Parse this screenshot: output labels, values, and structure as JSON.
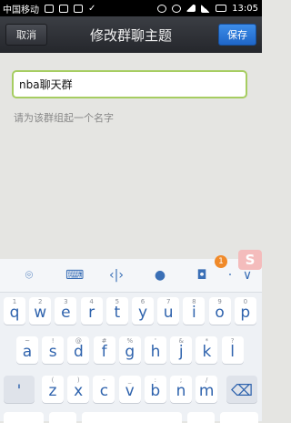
{
  "status_bar": {
    "carrier": "中国移动",
    "time": "13:05"
  },
  "header": {
    "cancel_label": "取消",
    "title": "修改群聊主题",
    "save_label": "保存"
  },
  "form": {
    "name_value": "nba聊天群",
    "hint": "请为该群组起一个名字"
  },
  "keyboard": {
    "toolbar_badge": "1",
    "toolbar_logo": "S",
    "toolbar_icons": [
      "attachment-icon",
      "keyboard-icon",
      "cursor-move-icon",
      "microphone-icon",
      "camera-icon",
      "more-dot-icon",
      "collapse-chevron-icon"
    ],
    "row1": [
      {
        "k": "q",
        "s": "1"
      },
      {
        "k": "w",
        "s": "2"
      },
      {
        "k": "e",
        "s": "3"
      },
      {
        "k": "r",
        "s": "4"
      },
      {
        "k": "t",
        "s": "5"
      },
      {
        "k": "y",
        "s": "6"
      },
      {
        "k": "u",
        "s": "7"
      },
      {
        "k": "i",
        "s": "8"
      },
      {
        "k": "o",
        "s": "9"
      },
      {
        "k": "p",
        "s": "0"
      }
    ],
    "row2": [
      {
        "k": "a",
        "s": "~"
      },
      {
        "k": "s",
        "s": "!"
      },
      {
        "k": "d",
        "s": "@"
      },
      {
        "k": "f",
        "s": "#"
      },
      {
        "k": "g",
        "s": "%"
      },
      {
        "k": "h",
        "s": "'"
      },
      {
        "k": "j",
        "s": "&"
      },
      {
        "k": "k",
        "s": "*"
      },
      {
        "k": "l",
        "s": "?"
      }
    ],
    "row3": [
      {
        "k": "z",
        "s": "("
      },
      {
        "k": "x",
        "s": ")"
      },
      {
        "k": "c",
        "s": "-"
      },
      {
        "k": "v",
        "s": "_"
      },
      {
        "k": "b",
        "s": ":"
      },
      {
        "k": "n",
        "s": ";"
      },
      {
        "k": "m",
        "s": "/"
      }
    ],
    "separator_key": "'",
    "backspace_icon": "backspace-icon"
  }
}
